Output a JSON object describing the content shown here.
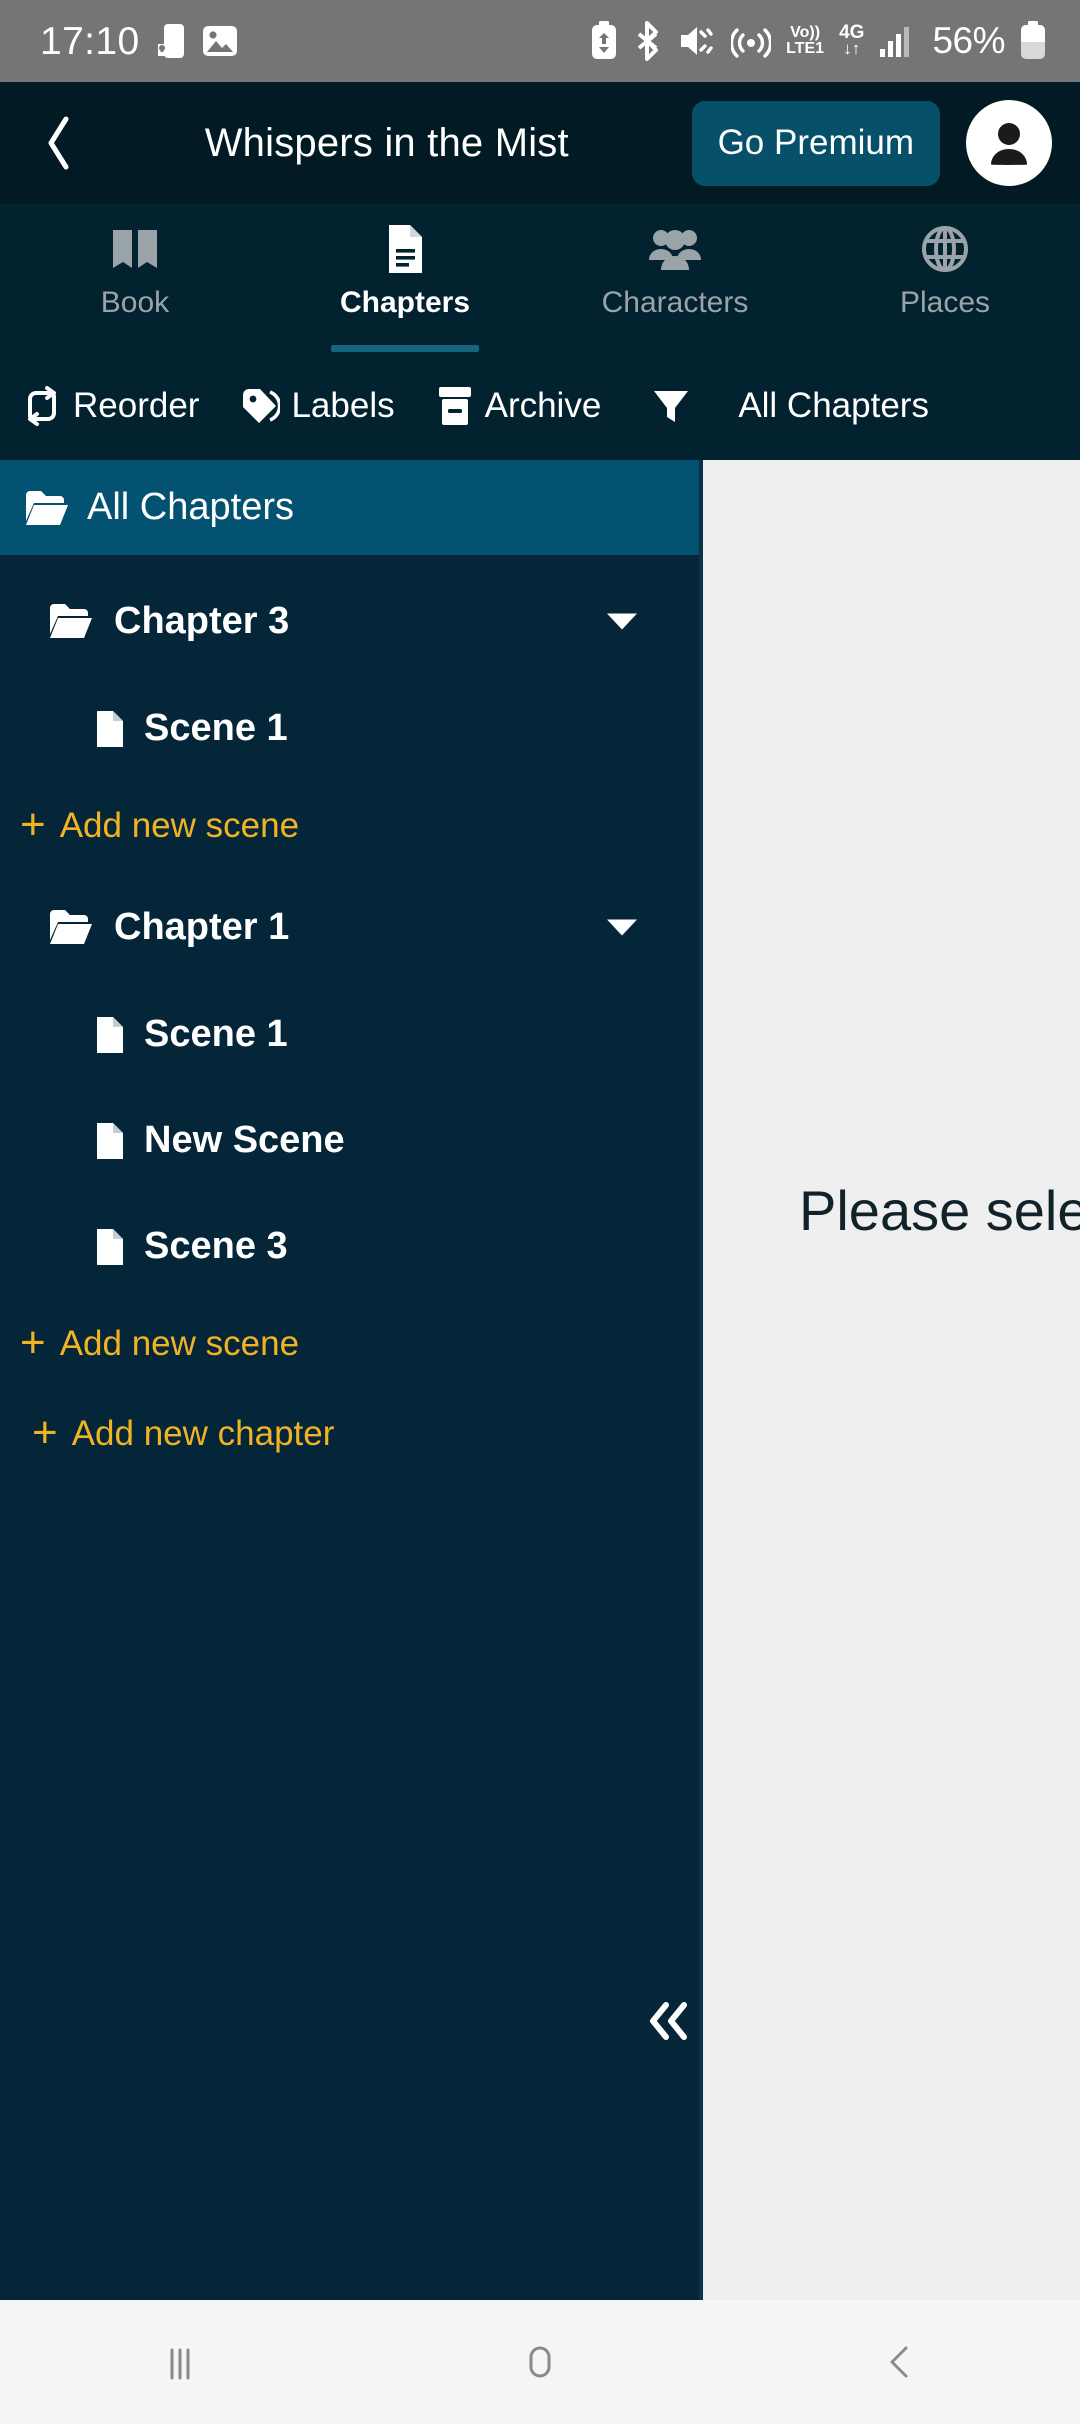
{
  "statusbar": {
    "time": "17:10",
    "battery_percent": "56%",
    "volte_top": "Vo))",
    "volte_bottom": "LTE1",
    "network_gen": "4G",
    "network_arrows": "↓↑",
    "icons": [
      "lock-screen-icon",
      "image-icon",
      "battery-saver-icon",
      "bluetooth-icon",
      "mute-vibrate-icon",
      "hotspot-icon",
      "volte-icon",
      "4g-data-icon",
      "signal-bars-icon",
      "battery-icon"
    ]
  },
  "header": {
    "back_label": "‹",
    "title": "Whispers in the Mist",
    "premium_label": "Go Premium",
    "avatar_name": "account-avatar"
  },
  "tabs": [
    {
      "label": "Book",
      "icon": "book-icon",
      "active": false
    },
    {
      "label": "Chapters",
      "icon": "document-icon",
      "active": true
    },
    {
      "label": "Characters",
      "icon": "people-icon",
      "active": false
    },
    {
      "label": "Places",
      "icon": "globe-icon",
      "active": false
    }
  ],
  "toolbar": {
    "reorder_label": "Reorder",
    "labels_label": "Labels",
    "archive_label": "Archive",
    "filter_icon": "filter-icon",
    "filter_value": "All Chapters"
  },
  "sidebar": {
    "all_chapters_label": "All Chapters",
    "items": [
      {
        "type": "chapter",
        "label": "Chapter 3",
        "expanded": true
      },
      {
        "type": "scene",
        "label": "Scene 1"
      },
      {
        "type": "add",
        "label": "Add new scene"
      },
      {
        "type": "chapter",
        "label": "Chapter 1",
        "expanded": true
      },
      {
        "type": "scene",
        "label": "Scene 1"
      },
      {
        "type": "scene",
        "label": "New Scene"
      },
      {
        "type": "scene",
        "label": "Scene 3"
      },
      {
        "type": "add",
        "label": "Add new scene"
      },
      {
        "type": "add-chapter",
        "label": "Add new chapter"
      }
    ],
    "collapse_icon": "collapse-left-double-chevron-icon"
  },
  "main": {
    "placeholder_text": "Please select a scene"
  },
  "navbar": {
    "recents": "recents-icon",
    "home": "home-icon",
    "back": "back-icon"
  },
  "colors": {
    "header_bg": "#021a23",
    "tab_bg": "#032230",
    "sidebar_bg": "#042638",
    "selected_bg": "#045271",
    "accent_teal": "#075069",
    "accent_yellow": "#f0b323",
    "main_bg": "#efefef",
    "status_bg": "#757575"
  }
}
